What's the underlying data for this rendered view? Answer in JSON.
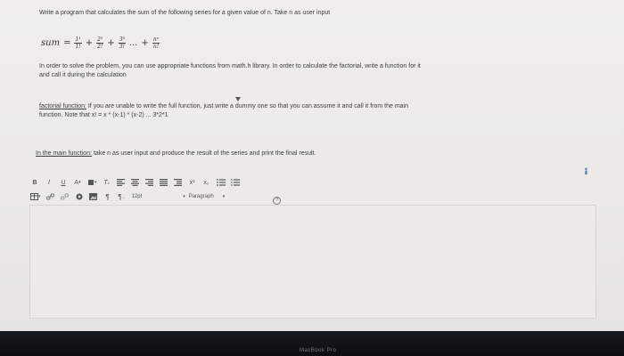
{
  "question": {
    "intro": "Write a program that calculates the sum of the following series for a given value of n. Take n as user input",
    "formula": {
      "lhs": "sum",
      "eq": "=",
      "terms": [
        {
          "num": "1¹",
          "den": "1!"
        },
        {
          "num": "2²",
          "den": "2!"
        },
        {
          "num": "3³",
          "den": "3!"
        },
        {
          "num": "nⁿ",
          "den": "n!"
        }
      ],
      "plus": "+",
      "ellipsis": "...",
      "plus_end": "+"
    },
    "para1_line1": "In order to solve the problem, you can use appropriate functions from math.h library. In order to calculate the factorial, write a function for it",
    "para1_line2": "and call it during the calculation",
    "factorial_label": "factorial function:",
    "factorial_line1": " If you are unable to write the full function, just write a dummy one so that you can assume it and call it from the main",
    "factorial_line2": "function. Note that x! = x * (x-1) * (x-2) ... 3*2*1",
    "main_label": "In the main function:",
    "main_text": " take n as user input and produce the result of the series and print the final result."
  },
  "toolbar": {
    "row1": [
      {
        "name": "bold-button",
        "label": "B"
      },
      {
        "name": "italic-button",
        "label": "I"
      },
      {
        "name": "underline-button",
        "label": "U"
      },
      {
        "name": "font-color-button",
        "label": "A"
      },
      {
        "name": "highlight-button",
        "label": "▾"
      },
      {
        "name": "clear-format-button",
        "label": "I̲"
      }
    ],
    "superscript": "x²",
    "subscript": "x₂",
    "font_size": "12pt",
    "paragraph": "Paragraph"
  },
  "colors": {
    "page_bg": "#efeeec",
    "bezel": "#111318",
    "text": "#3d3d3d"
  },
  "bezel_label": "MacBook Pro"
}
